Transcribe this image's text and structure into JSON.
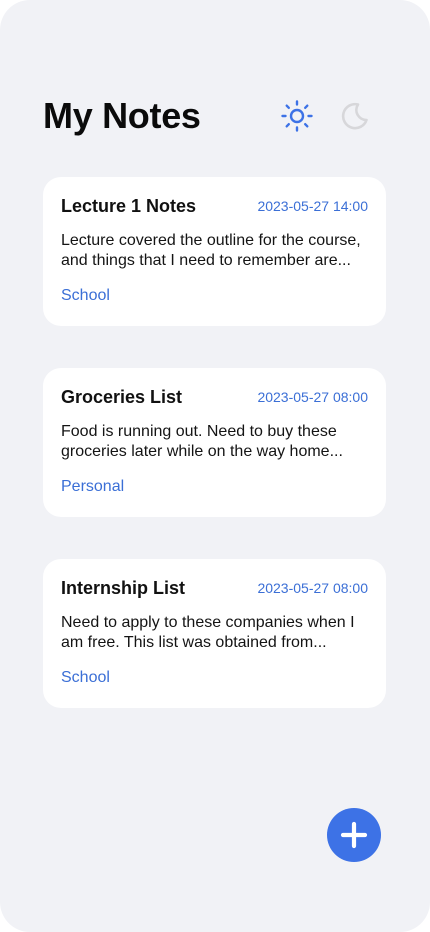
{
  "header": {
    "title": "My Notes",
    "light_icon": "sun-icon",
    "dark_icon": "moon-icon"
  },
  "colors": {
    "accent": "#3d72e6",
    "link": "#3b6fd6",
    "background": "#f1f2f6",
    "card": "#ffffff",
    "moon_inactive": "#d7d7da"
  },
  "notes": [
    {
      "title": "Lecture 1 Notes",
      "date": "2023-05-27 14:00",
      "body": "Lecture covered the outline for the course, and things that I need to remember are...",
      "tag": "School"
    },
    {
      "title": "Groceries List",
      "date": "2023-05-27 08:00",
      "body": "Food is running out. Need to buy these groceries later while on the way home...",
      "tag": "Personal"
    },
    {
      "title": "Internship List",
      "date": "2023-05-27 08:00",
      "body": "Need to apply to these companies when I am free. This list was obtained from...",
      "tag": "School"
    }
  ],
  "fab": {
    "icon": "plus-icon"
  }
}
